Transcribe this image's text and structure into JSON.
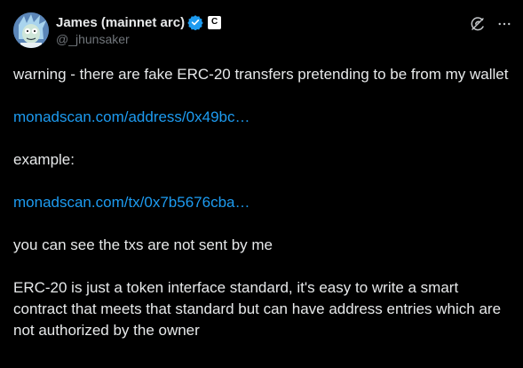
{
  "author": {
    "display_name": "James (mainnet arc)",
    "handle": "@_jhunsaker",
    "affiliation_badge": "C",
    "verified_color": "#1d9bf0",
    "avatar_icon": "avatar-cartoon-icon"
  },
  "actions": {
    "grok_icon": "grok-icon",
    "more_icon": "more-icon",
    "more_label": "···"
  },
  "tweet": {
    "p1": "warning - there are fake ERC-20 transfers pretending to be from my wallet",
    "link1": "monadscan.com/address/0x49bc…",
    "p2": "example:",
    "link2": "monadscan.com/tx/0x7b5676cba…",
    "p3": "you can see the txs are not sent by me",
    "p4": "ERC-20 is just a token interface standard, it's easy to write a smart contract that meets that standard but can have address entries which are not authorized by the owner"
  },
  "colors": {
    "background": "#000000",
    "text": "#e7e9ea",
    "secondary_text": "#71767b",
    "link": "#1d9bf0"
  }
}
